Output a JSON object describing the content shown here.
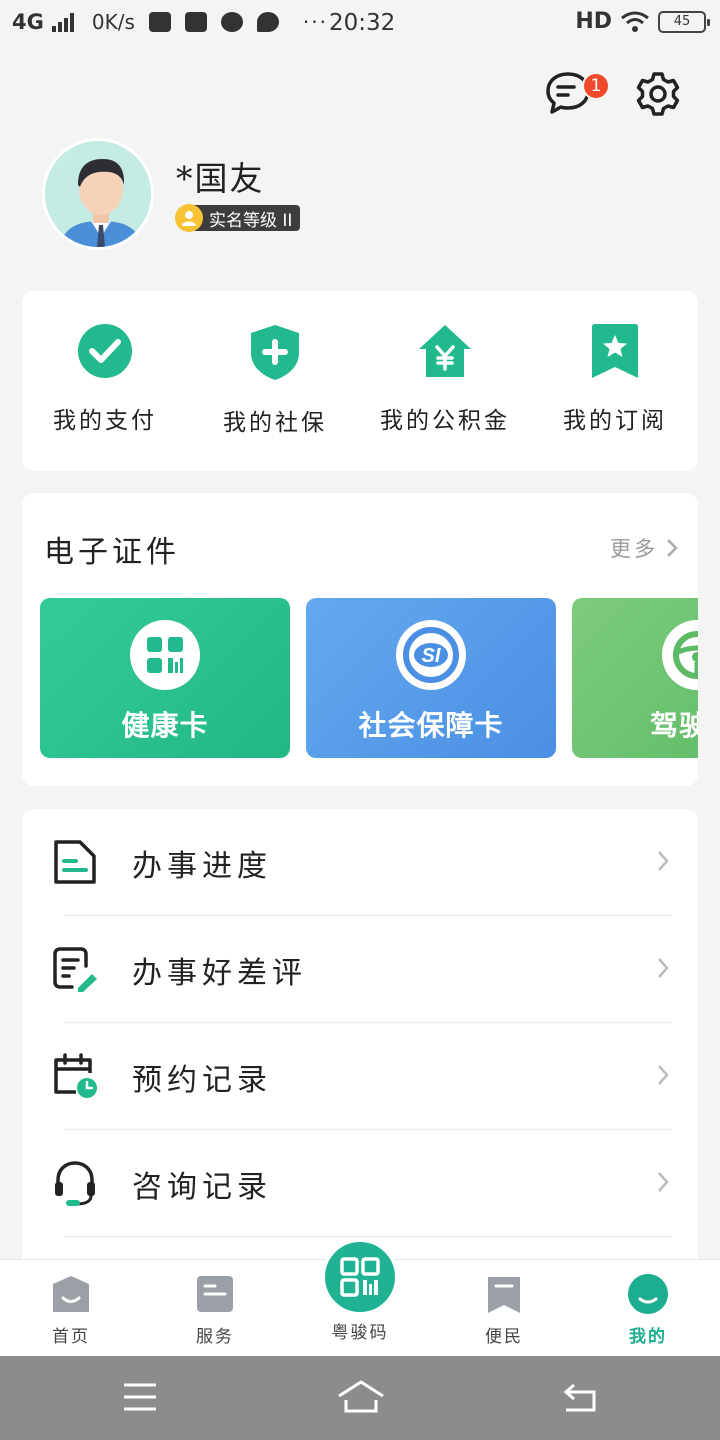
{
  "status_bar": {
    "network": "4G",
    "speed": "0K/s",
    "dots": "···",
    "time": "20:32",
    "hd": "HD",
    "battery": "45"
  },
  "header": {
    "message_badge": "1",
    "icons": [
      "message-icon",
      "gear-icon"
    ]
  },
  "profile": {
    "name": "*国友",
    "level": "实名等级 II"
  },
  "quick_actions": [
    {
      "label": "我的支付",
      "icon": "check-circle-icon"
    },
    {
      "label": "我的社保",
      "icon": "shield-plus-icon"
    },
    {
      "label": "我的公积金",
      "icon": "house-yen-icon"
    },
    {
      "label": "我的订阅",
      "icon": "bookmark-star-icon"
    }
  ],
  "certificates": {
    "title": "电子证件",
    "more": "更多",
    "cards": [
      {
        "label": "健康卡",
        "icon": "health-code-icon"
      },
      {
        "label": "社会保障卡",
        "icon": "social-security-icon"
      },
      {
        "label": "驾驶",
        "icon": "steering-wheel-icon"
      }
    ]
  },
  "menu": [
    {
      "label": "办事进度",
      "icon": "document-icon"
    },
    {
      "label": "办事好差评",
      "icon": "review-edit-icon"
    },
    {
      "label": "预约记录",
      "icon": "calendar-clock-icon"
    },
    {
      "label": "咨询记录",
      "icon": "headset-icon"
    }
  ],
  "tabs": [
    {
      "label": "首页",
      "icon": "home-icon"
    },
    {
      "label": "服务",
      "icon": "service-icon"
    },
    {
      "label": "粤骏码",
      "icon": "qr-code-icon"
    },
    {
      "label": "便民",
      "icon": "bookmark-icon"
    },
    {
      "label": "我的",
      "icon": "profile-icon"
    }
  ],
  "colors": {
    "accent": "#1fb394",
    "health_card": "#2bc28d",
    "social_card": "#5a9de9",
    "drive_card": "#6cc270",
    "badge": "#f04a2c"
  }
}
